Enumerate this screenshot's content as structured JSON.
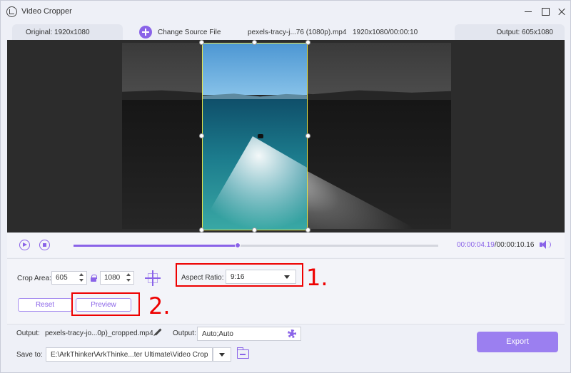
{
  "window": {
    "title": "Video Cropper"
  },
  "infobar": {
    "original": "Original: 1920x1080",
    "change_source": "Change Source File",
    "filename": "pexels-tracy-j...76 (1080p).mp4",
    "fileinfo": "1920x1080/00:00:10",
    "output": "Output: 605x1080"
  },
  "playback": {
    "current_time": "00:00:04.19",
    "total_time": "/00:00:10.16",
    "progress_fraction": 0.45
  },
  "crop": {
    "label": "Crop Area:",
    "width": "605",
    "height": "1080",
    "aspect_label": "Aspect Ratio:",
    "aspect_value": "9:16",
    "reset_label": "Reset",
    "preview_label": "Preview"
  },
  "annotations": {
    "step1": "1.",
    "step2": "2."
  },
  "output": {
    "label": "Output:",
    "filename": "pexels-tracy-jo...0p)_cropped.mp4",
    "settings_label": "Output:",
    "settings_value": "Auto;Auto"
  },
  "save": {
    "label": "Save to:",
    "path": "E:\\ArkThinker\\ArkThinke...ter Ultimate\\Video Crop"
  },
  "export_label": "Export",
  "colors": {
    "accent": "#8a63e8",
    "annotation": "#e00000",
    "crop_border": "#e8e84a"
  },
  "icons": [
    "app-icon",
    "minimize-icon",
    "maximize-icon",
    "close-icon",
    "plus-icon",
    "play-icon",
    "stop-icon",
    "volume-icon",
    "lock-icon",
    "center-crop-icon",
    "pencil-icon",
    "gear-icon",
    "chevron-down-icon",
    "folder-icon"
  ]
}
